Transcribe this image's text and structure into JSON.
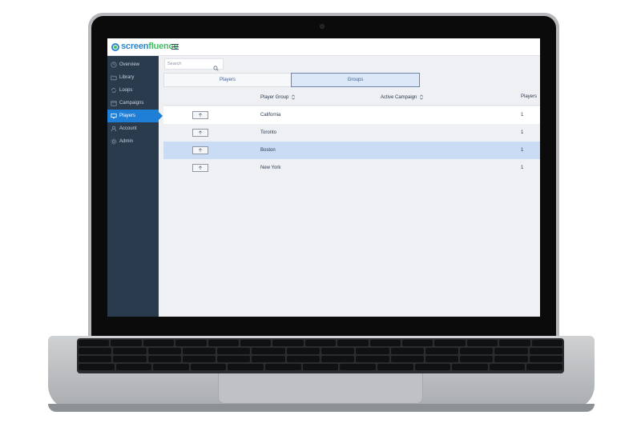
{
  "brand": {
    "part1": "screen",
    "part2": "fluence"
  },
  "sidebar": {
    "items": [
      {
        "label": "Overview",
        "icon": "clock-icon",
        "active": false
      },
      {
        "label": "Library",
        "icon": "folder-icon",
        "active": false
      },
      {
        "label": "Loops",
        "icon": "loop-icon",
        "active": false
      },
      {
        "label": "Campaigns",
        "icon": "calendar-icon",
        "active": false
      },
      {
        "label": "Players",
        "icon": "monitor-icon",
        "active": true
      },
      {
        "label": "Account",
        "icon": "user-icon",
        "active": false
      },
      {
        "label": "Admin",
        "icon": "gear-icon",
        "active": false
      }
    ]
  },
  "search": {
    "placeholder": "Search"
  },
  "tabs": [
    {
      "label": "Players",
      "active": false
    },
    {
      "label": "Groups",
      "active": true
    }
  ],
  "table": {
    "columns": [
      "Player Group",
      "Active Campaign",
      "Players"
    ],
    "rows": [
      {
        "group": "California",
        "campaign": "",
        "players": "1"
      },
      {
        "group": "Toronto",
        "campaign": "",
        "players": "1"
      },
      {
        "group": "Boston",
        "campaign": "",
        "players": "1"
      },
      {
        "group": "New York",
        "campaign": "",
        "players": "1"
      }
    ],
    "selected_row": 2
  },
  "colors": {
    "sidebar_bg": "#2b3b4e",
    "active_nav": "#1f7ed6",
    "brand_blue": "#2e86c8",
    "brand_green": "#3fbf5f",
    "selected_row": "#c9dcf3"
  }
}
